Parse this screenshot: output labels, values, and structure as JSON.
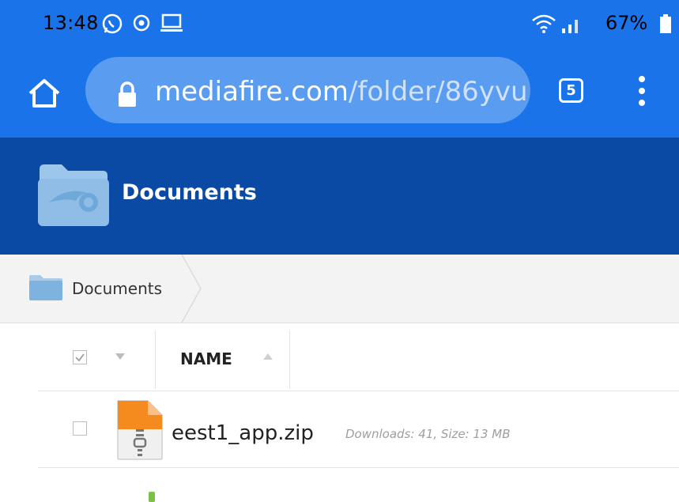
{
  "status_bar": {
    "time": "13:48",
    "icons": [
      "whatsapp-icon",
      "chrome-notification-icon",
      "screen-cast-icon",
      "wifi-icon",
      "signal-icon",
      "battery-icon"
    ],
    "battery_percent": "67%"
  },
  "browser": {
    "url_domain": "mediafire.com",
    "url_path": "/folder/86yvu",
    "tab_count": "5",
    "accent_color": "#1a73e8"
  },
  "folder": {
    "title": "Documents",
    "header_color": "#0a4aa5"
  },
  "breadcrumb": {
    "items": [
      {
        "label": "Documents"
      }
    ]
  },
  "file_list": {
    "column_name": "NAME",
    "rows": [
      {
        "name": "eest1_app.zip",
        "meta": "Downloads: 41, Size: 13 MB",
        "icon": "zip-file-icon"
      }
    ]
  }
}
